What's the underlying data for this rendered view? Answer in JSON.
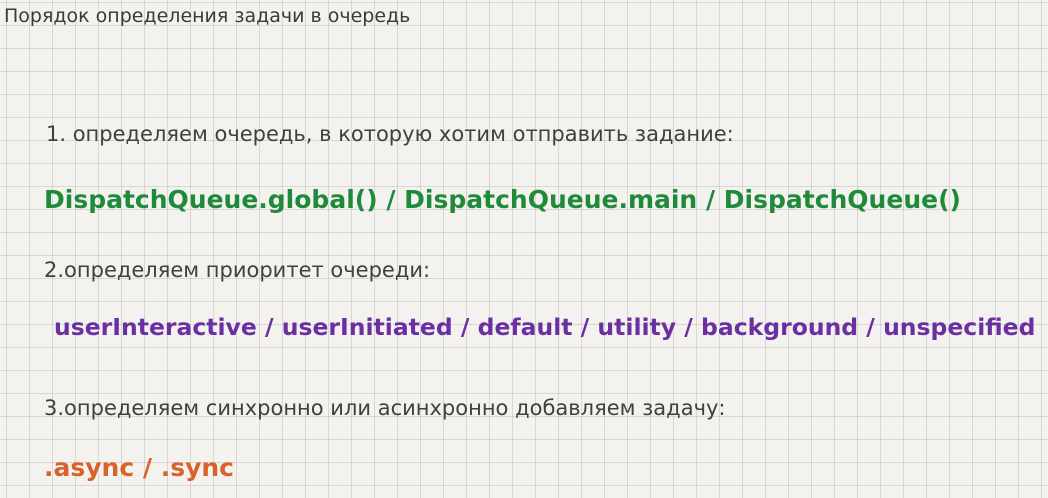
{
  "title": "Порядок определения задачи в очередь",
  "steps": [
    {
      "text": "1. определяем очередь, в которую хотим отправить задание:",
      "code": "DispatchQueue.global() / DispatchQueue.main / DispatchQueue()",
      "code_color": "#1e8a3a"
    },
    {
      "text": "2.определяем приоритет очереди:",
      "code": "userInteractive / userInitiated / default / utility / background / unspecified",
      "code_color": "#6b2fa3"
    },
    {
      "text": "3.определяем синхронно или асинхронно добавляем задачу:",
      "code": ".async / .sync",
      "code_color": "#d9622a"
    }
  ]
}
